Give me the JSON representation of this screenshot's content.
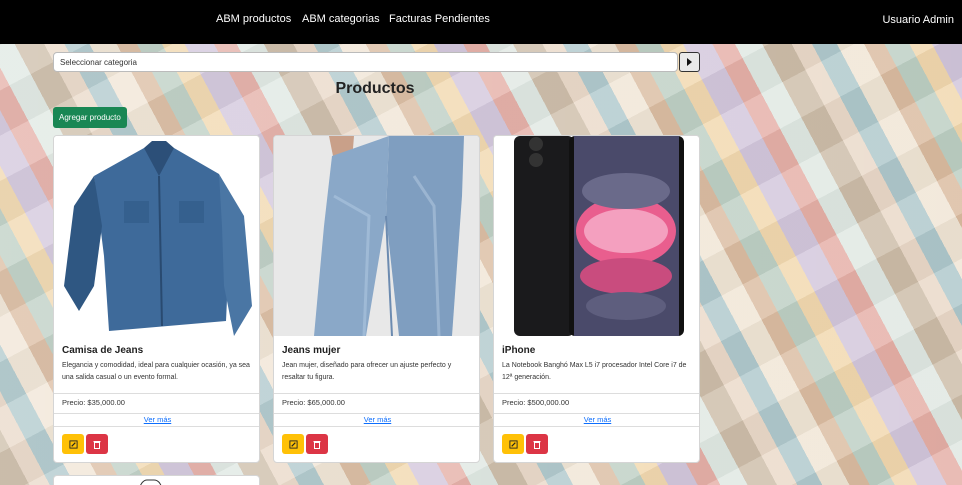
{
  "navbar": {
    "links": [
      "ABM productos",
      "ABM categorias",
      "Facturas Pendientes"
    ],
    "user": "Usuario Admin"
  },
  "search": {
    "placeholder": "Seleccionar categoria"
  },
  "page": {
    "title": "Productos",
    "add_button": "Agregar producto"
  },
  "products": [
    {
      "name": "Camisa de Jeans",
      "description": "Elegancia y comodidad, ideal para cualquier ocasión, ya sea una salida casual o un evento formal.",
      "price": "Precio: $35,000.00",
      "more": "Ver más",
      "image_icon": "denim-shirt-image"
    },
    {
      "name": "Jeans mujer",
      "description": "Jean mujer, diseñado para ofrecer un ajuste perfecto y resaltar tu figura.",
      "price": "Precio: $65,000.00",
      "more": "Ver más",
      "image_icon": "jeans-image"
    },
    {
      "name": "iPhone",
      "description": "La Notebook Banghó Max L5 i7 procesador Intel Core i7 de 12ª generación.",
      "price": "Precio: $500,000.00",
      "more": "Ver más",
      "image_icon": "iphone-image"
    }
  ],
  "colors": {
    "navbar": "#000000",
    "add": "#198754",
    "edit": "#ffc107",
    "delete": "#dc3545",
    "link": "#0d6efd"
  }
}
